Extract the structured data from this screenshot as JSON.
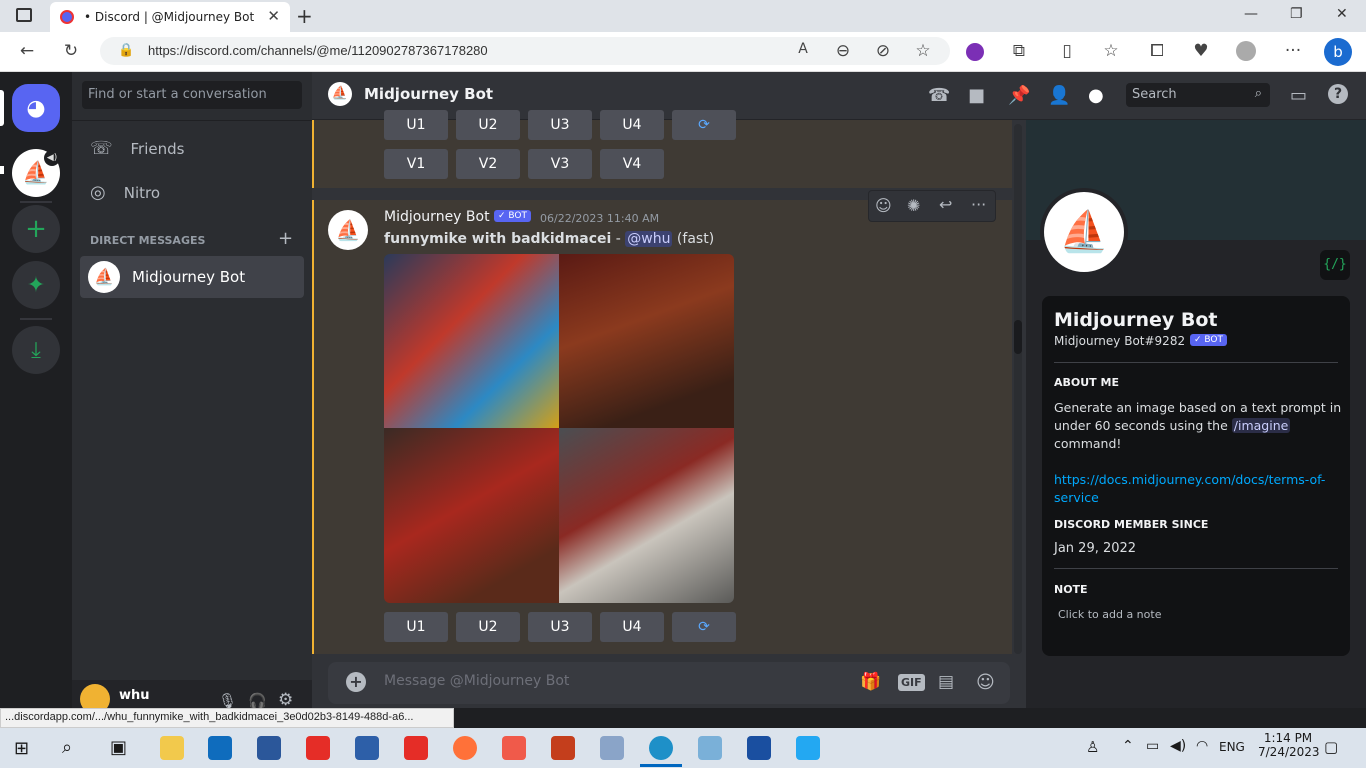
{
  "browser": {
    "tab_title": "• Discord | @Midjourney Bot",
    "url": "https://discord.com/channels/@me/1120902787367178280",
    "status_link": "...discordapp.com/.../whu_funnymike_with_badkidmacei_3e0d02b3-8149-488d-a6..."
  },
  "sidebar": {
    "search_placeholder": "Find or start a conversation",
    "nav": [
      {
        "label": "Friends"
      },
      {
        "label": "Nitro"
      }
    ],
    "dm_header": "DIRECT MESSAGES",
    "dms": [
      {
        "label": "Midjourney Bot"
      }
    ],
    "user": {
      "name": "whu"
    }
  },
  "header": {
    "title": "Midjourney Bot",
    "search_placeholder": "Search"
  },
  "message": {
    "author": "Midjourney Bot",
    "badge": "✓ BOT",
    "timestamp": "06/22/2023 11:40 AM",
    "prompt": "funnymike with badkidmacei",
    "dash": " - ",
    "mention": "@whu",
    "mode": " (fast)",
    "upscale_buttons": [
      "U1",
      "U2",
      "U3",
      "U4"
    ],
    "variation_buttons": [
      "V1",
      "V2",
      "V3",
      "V4"
    ]
  },
  "composer": {
    "placeholder": "Message @Midjourney Bot",
    "gif": "GIF"
  },
  "profile": {
    "name": "Midjourney Bot",
    "tag": "Midjourney Bot#9282",
    "badge": "✓ BOT",
    "about_label": "ABOUT ME",
    "about_1": "Generate an image based on a text prompt in",
    "about_2a": "under 60 seconds using the ",
    "about_cmd": "/imagine",
    "about_3": "command!",
    "link_1": "https://docs.midjourney.com/docs/terms-of-",
    "link_2": "service",
    "member_label": "DISCORD MEMBER SINCE",
    "member_since": "Jan 29, 2022",
    "note_label": "NOTE",
    "note_placeholder": "Click to add a note",
    "code_icon": "{/}"
  },
  "taskbar": {
    "time": "1:14 PM",
    "date": "7/24/2023",
    "lang": "ENG"
  },
  "colors": {
    "accent": "#5865f2",
    "link": "#00a8fc",
    "gold": "#f0b232"
  }
}
